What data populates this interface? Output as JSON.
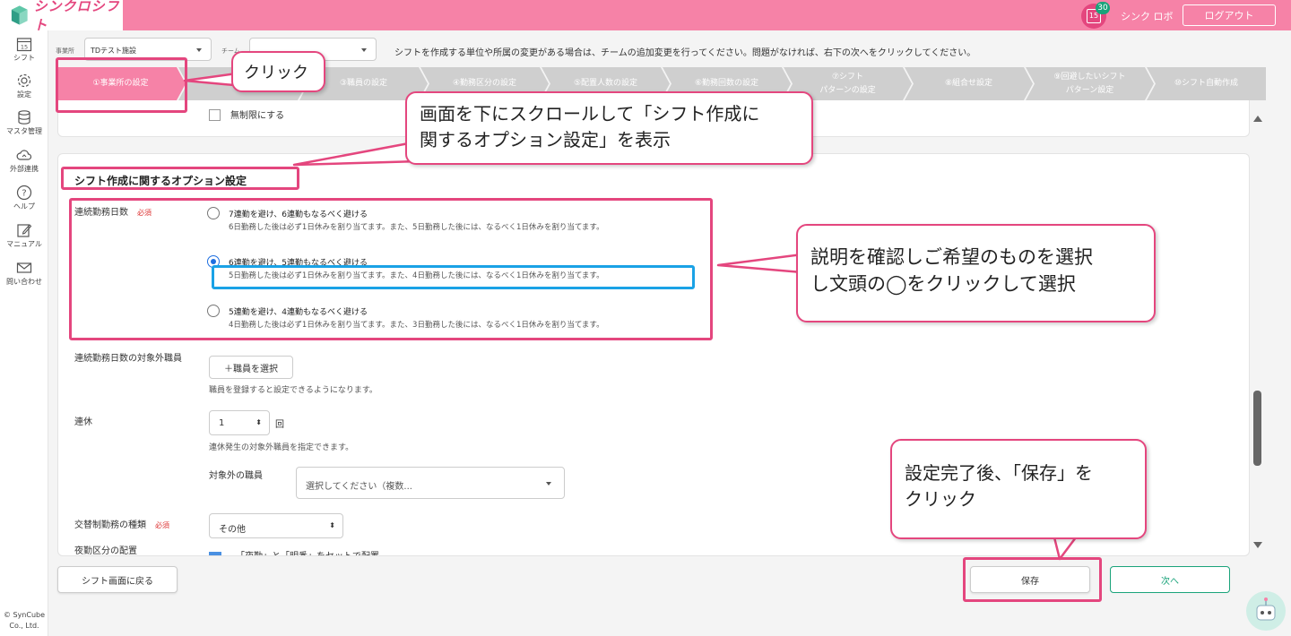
{
  "header": {
    "app_name": "シンクロシフト",
    "calendar_day": "15",
    "notification_count": "30",
    "user_name": "シンク ロボ",
    "logout_label": "ログアウト"
  },
  "sidenav": {
    "items": [
      {
        "label": "シフト",
        "icon": "calendar-icon",
        "day": "15"
      },
      {
        "label": "設定",
        "icon": "gear-icon"
      },
      {
        "label": "マスタ管理",
        "icon": "database-icon"
      },
      {
        "label": "外部連携",
        "icon": "cloud-icon"
      },
      {
        "label": "ヘルプ",
        "icon": "help-icon"
      },
      {
        "label": "マニュアル",
        "icon": "manual-icon"
      },
      {
        "label": "問い合わせ",
        "icon": "mail-icon"
      }
    ],
    "copyright_line1": "© SynCube",
    "copyright_line2": "Co., Ltd."
  },
  "filters": {
    "office_label": "事業所",
    "office_value": "TDテスト施設",
    "team_label": "チーム",
    "notice": "シフトを作成する単位や所属の変更がある場合は、チームの追加変更を行ってください。問題がなければ、右下の次へをクリックしてください。"
  },
  "steps": [
    {
      "line1": "①事業所の設定",
      "line2": ""
    },
    {
      "line1": "②チ",
      "line2": ""
    },
    {
      "line1": "③職員の設定",
      "line2": ""
    },
    {
      "line1": "④勤務区分の設定",
      "line2": ""
    },
    {
      "line1": "⑤配置人数の設定",
      "line2": ""
    },
    {
      "line1": "⑥勤務回数の設定",
      "line2": ""
    },
    {
      "line1": "⑦シフト",
      "line2": "パターンの設定"
    },
    {
      "line1": "⑧組合せ設定",
      "line2": ""
    },
    {
      "line1": "⑨回避したいシフト",
      "line2": "パターン設定"
    },
    {
      "line1": "⑩シフト自動作成",
      "line2": ""
    }
  ],
  "top_panel": {
    "partial_checkbox_label": "無制限にする"
  },
  "options": {
    "section_title": "シフト作成に関するオプション設定",
    "consecutive": {
      "label": "連続勤務日数",
      "required": "必須",
      "choices": [
        {
          "title": "7連勤を避け、6連勤もなるべく避ける",
          "desc": "6日勤務した後は必ず1日休みを割り当てます。また、5日勤務した後には、なるべく1日休みを割り当てます。",
          "checked": false
        },
        {
          "title": "6連勤を避け、5連勤もなるべく避ける",
          "desc": "5日勤務した後は必ず1日休みを割り当てます。また、4日勤務した後には、なるべく1日休みを割り当てます。",
          "checked": true
        },
        {
          "title": "5連勤を避け、4連勤もなるべく避ける",
          "desc": "4日勤務した後は必ず1日休みを割り当てます。また、3日勤務した後には、なるべく1日休みを割り当てます。",
          "checked": false
        }
      ]
    },
    "excluded_staff": {
      "label": "連続勤務日数の対象外職員",
      "button": "＋職員を選択",
      "hint": "職員を登録すると設定できるようになります。"
    },
    "rest": {
      "label": "連休",
      "value": "1",
      "unit": "回",
      "hint": "連休発生の対象外職員を指定できます。",
      "excluded_label": "対象外の職員",
      "excluded_placeholder": "選択してください（複数..."
    },
    "shift_type": {
      "label": "交替制勤務の種類",
      "required": "必須",
      "value": "その他"
    },
    "night": {
      "label": "夜勤区分の配置",
      "cut_text": "「夜勤」と「明番」をセットで配置"
    }
  },
  "footer": {
    "back_label": "シフト画面に戻る",
    "save_label": "保存",
    "next_label": "次へ"
  },
  "annotations": {
    "click": "クリック",
    "scroll_line1": "画面を下にスクロールして「シフト作成に",
    "scroll_line2": "関するオプション設定」を表示",
    "choose_line1": "説明を確認しご希望のものを選択",
    "choose_line2": "し文頭の◯をクリックして選択",
    "save_line1": "設定完了後、「保存」を",
    "save_line2": "クリック"
  },
  "colors": {
    "brand_pink": "#f682a7",
    "annotation_pink": "#e4467e",
    "highlight_blue": "#1aa2e6",
    "next_green": "#1aa37a"
  }
}
